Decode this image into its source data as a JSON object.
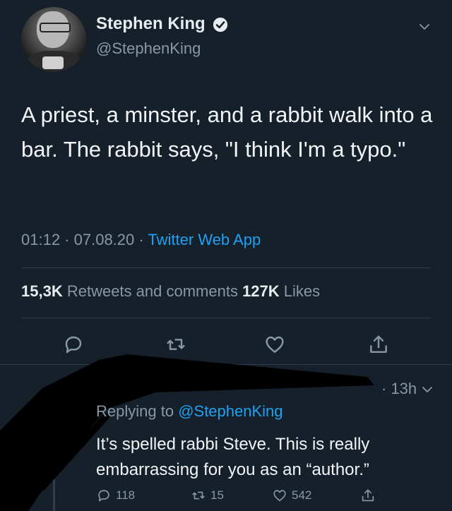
{
  "tweet": {
    "author": {
      "display_name": "Stephen King",
      "handle": "@StephenKing",
      "verified": true
    },
    "text": "A priest, a minster, and a rabbit walk into a bar. The rabbit says, \"I think I'm a typo.\"",
    "meta": {
      "time": "01:12",
      "sep1": " · ",
      "date": "07.08.20",
      "sep2": " · ",
      "source": "Twitter Web App"
    },
    "stats": {
      "retweets_count": "15,3K",
      "retweets_label": " Retweets and comments ",
      "likes_count": "127K",
      "likes_label": " Likes"
    },
    "actions": [
      "reply-icon",
      "retweet-icon",
      "like-icon",
      "share-icon"
    ]
  },
  "reply": {
    "time": "· 13h",
    "replying_prefix": "Replying to ",
    "replying_to": "@StephenKing",
    "text": "It’s spelled rabbi Steve. This is really embarrassing for you as an “author.”",
    "counts": {
      "replies": "118",
      "retweets": "15",
      "likes": "542"
    }
  },
  "colors": {
    "background": "#15202b",
    "accent": "#1da1f2",
    "secondary_text": "#8899a6",
    "divider": "#2f3d4a"
  }
}
